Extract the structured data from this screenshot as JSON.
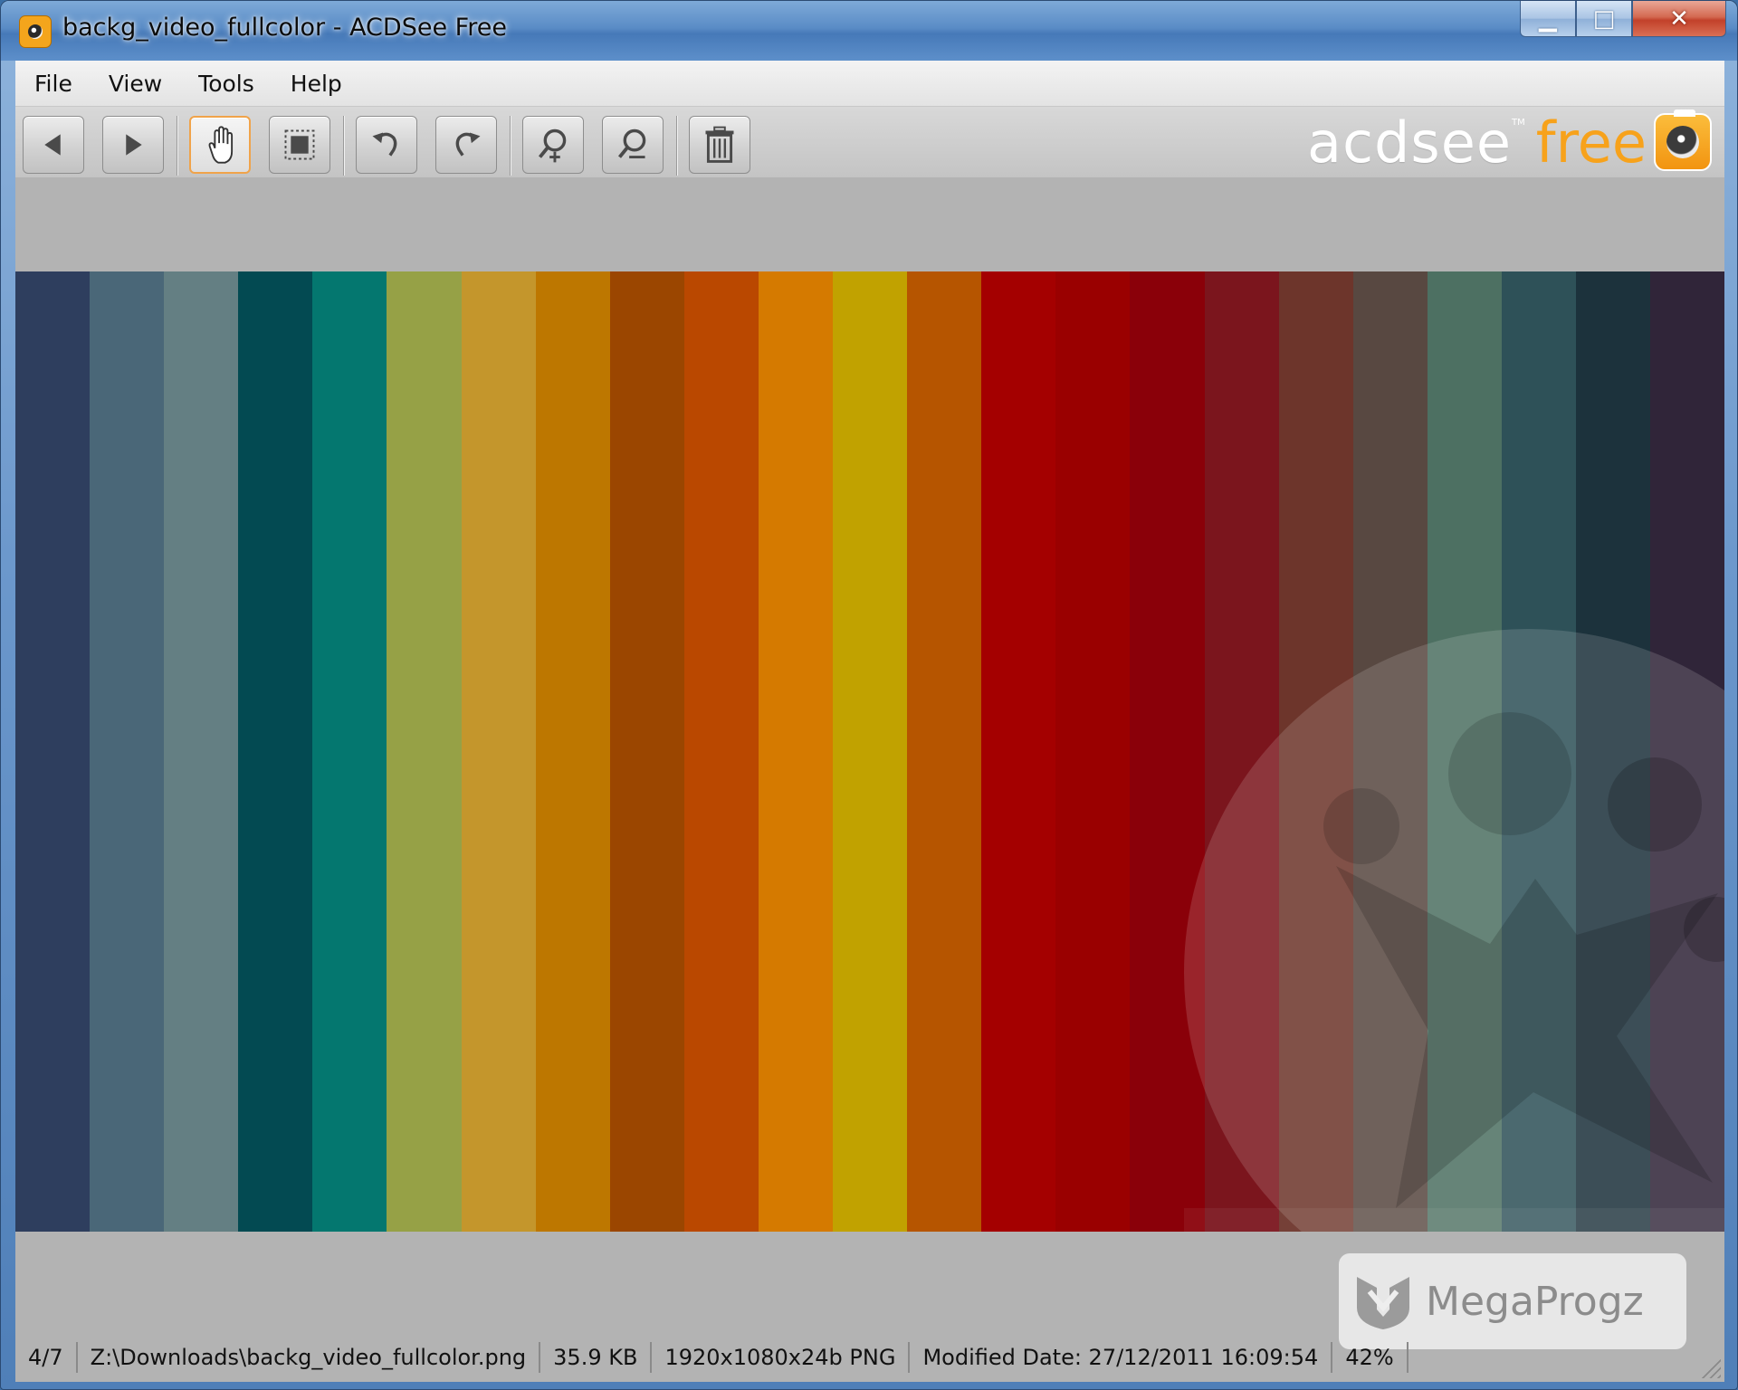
{
  "window": {
    "title": "backg_video_fullcolor - ACDSee Free",
    "caption_buttons": {
      "minimize": "▁",
      "maximize": "□",
      "close": "✕"
    }
  },
  "menu": [
    "File",
    "View",
    "Tools",
    "Help"
  ],
  "toolbar": {
    "buttons": [
      {
        "name": "previous-button",
        "icon": "arrow-left-icon",
        "active": false
      },
      {
        "name": "next-button",
        "icon": "arrow-right-icon",
        "active": false
      },
      {
        "name": "pan-button",
        "icon": "hand-icon",
        "active": true
      },
      {
        "name": "select-button",
        "icon": "selection-icon",
        "active": false
      },
      {
        "name": "rotate-left-button",
        "icon": "rotate-left-icon",
        "active": false
      },
      {
        "name": "rotate-right-button",
        "icon": "rotate-right-icon",
        "active": false
      },
      {
        "name": "zoom-in-button",
        "icon": "zoom-in-icon",
        "active": false
      },
      {
        "name": "zoom-out-button",
        "icon": "zoom-out-icon",
        "active": false
      },
      {
        "name": "delete-button",
        "icon": "trash-icon",
        "active": false
      }
    ]
  },
  "logo": {
    "brand": "acdsee",
    "tm": "TM",
    "edition": "free"
  },
  "image": {
    "stripes": [
      "#2e3e5e",
      "#4a6778",
      "#647f83",
      "#034a52",
      "#04776f",
      "#96a146",
      "#c4962c",
      "#bd7700",
      "#9b4600",
      "#ba4800",
      "#d57a00",
      "#c1a200",
      "#b65500",
      "#a40000",
      "#9a0000",
      "#8a0009",
      "#7b151d",
      "#6d352b",
      "#584841",
      "#4d7062",
      "#2e5158",
      "#1c323c",
      "#302539"
    ]
  },
  "promo": {
    "text": "MegaProgz"
  },
  "status": {
    "position": "4/7",
    "path": "Z:\\Downloads\\backg_video_fullcolor.png",
    "size": "35.9 KB",
    "dimensions": "1920x1080x24b PNG",
    "modified": "Modified Date: 27/12/2011 16:09:54",
    "zoom": "42%"
  },
  "colors": {
    "accent": "#f7a21b",
    "active_border": "#f0a34a",
    "canvas_bg": "#b3b3b3"
  }
}
